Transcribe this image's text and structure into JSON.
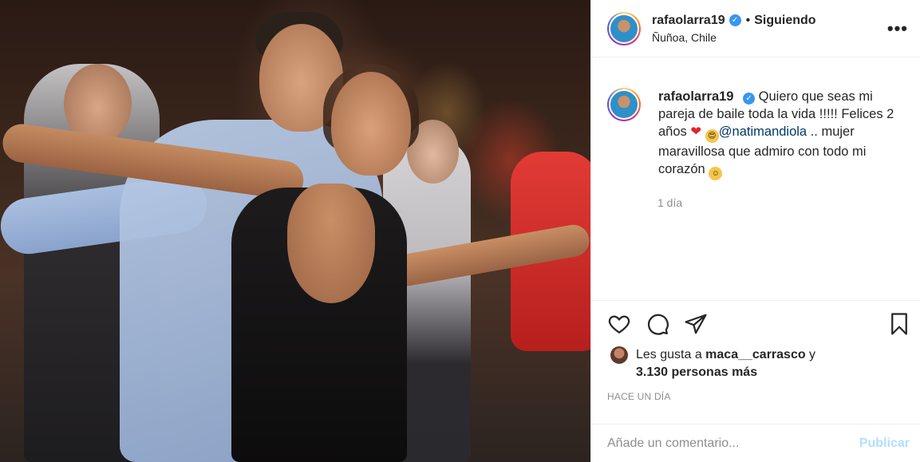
{
  "post": {
    "username": "rafaolarra19",
    "verified_glyph": "✓",
    "separator": "•",
    "follow_status": "Siguiendo",
    "location": "Ñuñoa, Chile",
    "more_glyph": "•••",
    "caption": {
      "username": "rafaolarra19",
      "text_part1": "Quiero que seas mi pareja de baile toda la vida !!!!! Felices 2 años ",
      "heart": "❤",
      "mention": "@natimandiola",
      "text_part2": " .. mujer maravillosa que admiro con todo mi corazón ",
      "smile_emoji": "☺"
    },
    "caption_age": "1 día",
    "likes": {
      "prefix": "Les gusta a ",
      "user": "maca__carrasco",
      "middle": " y",
      "count": "3.130 personas más"
    },
    "timestamp": "HACE UN DÍA",
    "comment": {
      "placeholder": "Añade un comentario...",
      "post_label": "Publicar"
    }
  },
  "icons": [
    "heart-icon",
    "comment-icon",
    "share-icon",
    "bookmark-icon",
    "verified-icon",
    "more-options-icon"
  ],
  "colors": {
    "link": "#00376b",
    "verified": "#3897f0",
    "muted": "#8e8e8e",
    "publish_disabled": "#b2dffc"
  }
}
